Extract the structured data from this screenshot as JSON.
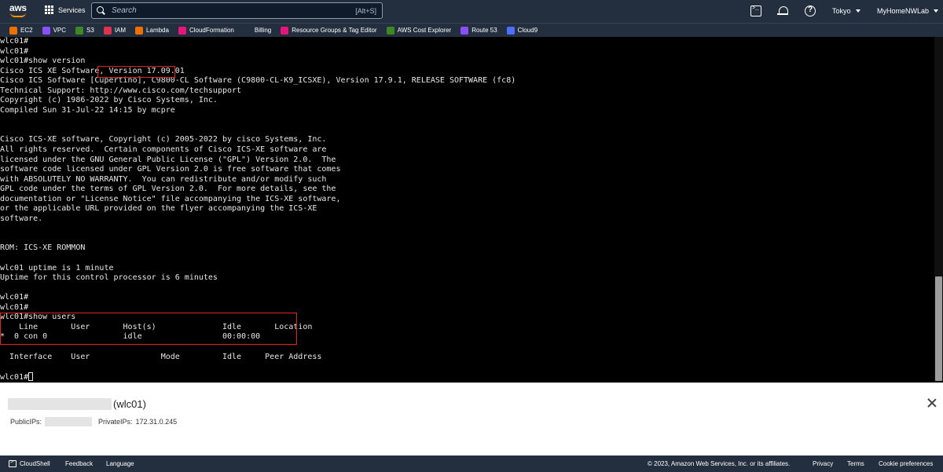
{
  "topnav": {
    "logo": "aws",
    "services_label": "Services",
    "search_placeholder": "Search",
    "search_shortcut": "[Alt+S]",
    "region": "Tokyo",
    "account": "MyHomeNWLab"
  },
  "favorites": [
    {
      "label": "EC2",
      "icon": "ec2-icon",
      "color": "#ed7100"
    },
    {
      "label": "VPC",
      "icon": "vpc-icon",
      "color": "#8c4fff"
    },
    {
      "label": "S3",
      "icon": "s3-icon",
      "color": "#3f8624"
    },
    {
      "label": "IAM",
      "icon": "iam-icon",
      "color": "#dd344c"
    },
    {
      "label": "Lambda",
      "icon": "lambda-icon",
      "color": "#ed7100"
    },
    {
      "label": "CloudFormation",
      "icon": "cloudformation-icon",
      "color": "#e7157b"
    },
    {
      "label": "Billing",
      "icon": "billing-icon",
      "color": "#232f3e"
    },
    {
      "label": "Resource Groups & Tag Editor",
      "icon": "resource-groups-icon",
      "color": "#e7157b"
    },
    {
      "label": "AWS Cost Explorer",
      "icon": "cost-explorer-icon",
      "color": "#3f8624"
    },
    {
      "label": "Route 53",
      "icon": "route53-icon",
      "color": "#8c4fff"
    },
    {
      "label": "Cloud9",
      "icon": "cloud9-icon",
      "color": "#4c6fff"
    }
  ],
  "terminal": {
    "lines": [
      "wlc01#",
      "wlc01#",
      "wlc01#show version",
      "Cisco ICS XE Software, Version 17.09.01",
      "Cisco ICS Software [Cupertino], C9800-CL Software (C9800-CL-K9_ICSXE), Version 17.9.1, RELEASE SOFTWARE (fc8)",
      "Technical Support: http://www.cisco.com/techsupport",
      "Copyright (c) 1986-2022 by Cisco Systems, Inc.",
      "Compiled Sun 31-Jul-22 14:15 by mcpre",
      "",
      "",
      "Cisco ICS-XE software, Copyright (c) 2005-2022 by cisco Systems, Inc.",
      "All rights reserved.  Certain components of Cisco ICS-XE software are",
      "licensed under the GNU General Public License (\"GPL\") Version 2.0.  The",
      "software code licensed under GPL Version 2.0 is free software that comes",
      "with ABSOLUTELY NO WARRANTY.  You can redistribute and/or modify such",
      "GPL code under the terms of GPL Version 2.0.  For more details, see the",
      "documentation or \"License Notice\" file accompanying the ICS-XE software,",
      "or the applicable URL provided on the flyer accompanying the ICS-XE",
      "software.",
      "",
      "",
      "ROM: ICS-XE ROMMON",
      "",
      "wlc01 uptime is 1 minute",
      "Uptime for this control processor is 6 minutes",
      "",
      "wlc01#",
      "wlc01#",
      "wlc01#show users",
      "    Line       User       Host(s)              Idle       Location",
      "*  0 con 0                idle                 00:00:00",
      "",
      "  Interface    User               Mode         Idle     Peer Address",
      "",
      "wlc01#"
    ]
  },
  "instance": {
    "name_suffix": "(wlc01)",
    "public_ips_label": "PublicIPs:",
    "private_ips_label": "PrivateIPs:",
    "private_ip": "172.31.0.245"
  },
  "footer": {
    "cloudshell": "CloudShell",
    "feedback": "Feedback",
    "language": "Language",
    "copyright": "© 2023, Amazon Web Services, Inc. or its affiliates.",
    "privacy": "Privacy",
    "terms": "Terms",
    "cookies": "Cookie preferences"
  },
  "colors": {
    "nav_bg": "#232f3e",
    "highlight": "#e0231b",
    "terminal_bg": "#000000"
  }
}
